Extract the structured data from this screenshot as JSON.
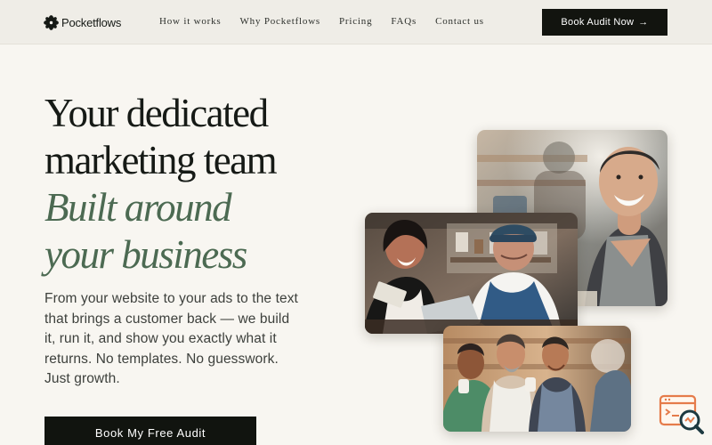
{
  "brand": {
    "name": "Pocketflows",
    "logo_icon": "flower-icon"
  },
  "nav": {
    "items": [
      "How it works",
      "Why Pocketflows",
      "Pricing",
      "FAQs",
      "Contact us"
    ],
    "cta_label": "Book Audit Now",
    "cta_icon": "arrow-right-icon"
  },
  "hero": {
    "title_line_1": "Your dedicated",
    "title_line_2": "marketing team",
    "title_line_3": "Built around",
    "title_line_4": "your business",
    "body": "From your website to your ads to the text that brings a customer back — we build it, run it, and show you exactly what it returns. No templates. No guesswork. Just growth.",
    "cta_label": "Book My Free Audit"
  },
  "photos": [
    "smiling-man-in-apron-photo",
    "cafe-team-with-laptop-photo",
    "group-of-business-owners-photo"
  ],
  "floating_widget": {
    "icon": "browser-search-icon"
  },
  "colors": {
    "background": "#f8f6f1",
    "header_background": "#efede7",
    "text": "#161a16",
    "accent_green": "#4c6a52",
    "button": "#12140f",
    "widget_orange": "#e57b4a"
  }
}
